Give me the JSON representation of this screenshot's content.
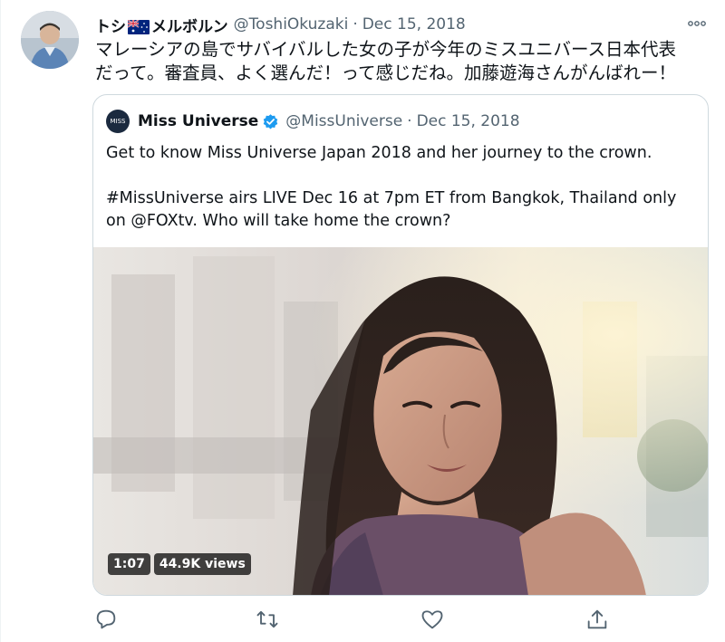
{
  "tweet": {
    "display_name_part1": "トシ",
    "display_name_part2": "メルボルン",
    "flag_icon": "australia-flag-icon",
    "handle": "@ToshiOkuzaki",
    "separator": "·",
    "date": "Dec 15, 2018",
    "more_icon": "more-options-icon",
    "text": "マレーシアの島でサバイバルした女の子が今年のミスユニバース日本代表\nだって。審査員、よく選んだ！って感じだね。加藤遊海さんがんばれー！"
  },
  "quote": {
    "avatar_text": "MISS",
    "display_name": "Miss Universe",
    "verified_icon": "verified-badge-icon",
    "handle": "@MissUniverse",
    "separator": "·",
    "date": "Dec 15, 2018",
    "text": "Get to know Miss Universe Japan 2018 and her journey to the crown.\n\n#MissUniverse airs LIVE Dec 16 at 7pm ET from Bangkok, Thailand only\non @FOXtv. Who will take home the crown?",
    "video": {
      "duration": "1:07",
      "views": "44.9K views"
    }
  },
  "actions": {
    "reply_icon": "reply-icon",
    "retweet_icon": "retweet-icon",
    "like_icon": "like-icon",
    "share_icon": "share-icon"
  },
  "colors": {
    "text_primary": "#0f1419",
    "text_secondary": "#536471",
    "verified_blue": "#1d9bf0",
    "border": "#cfd9de"
  }
}
